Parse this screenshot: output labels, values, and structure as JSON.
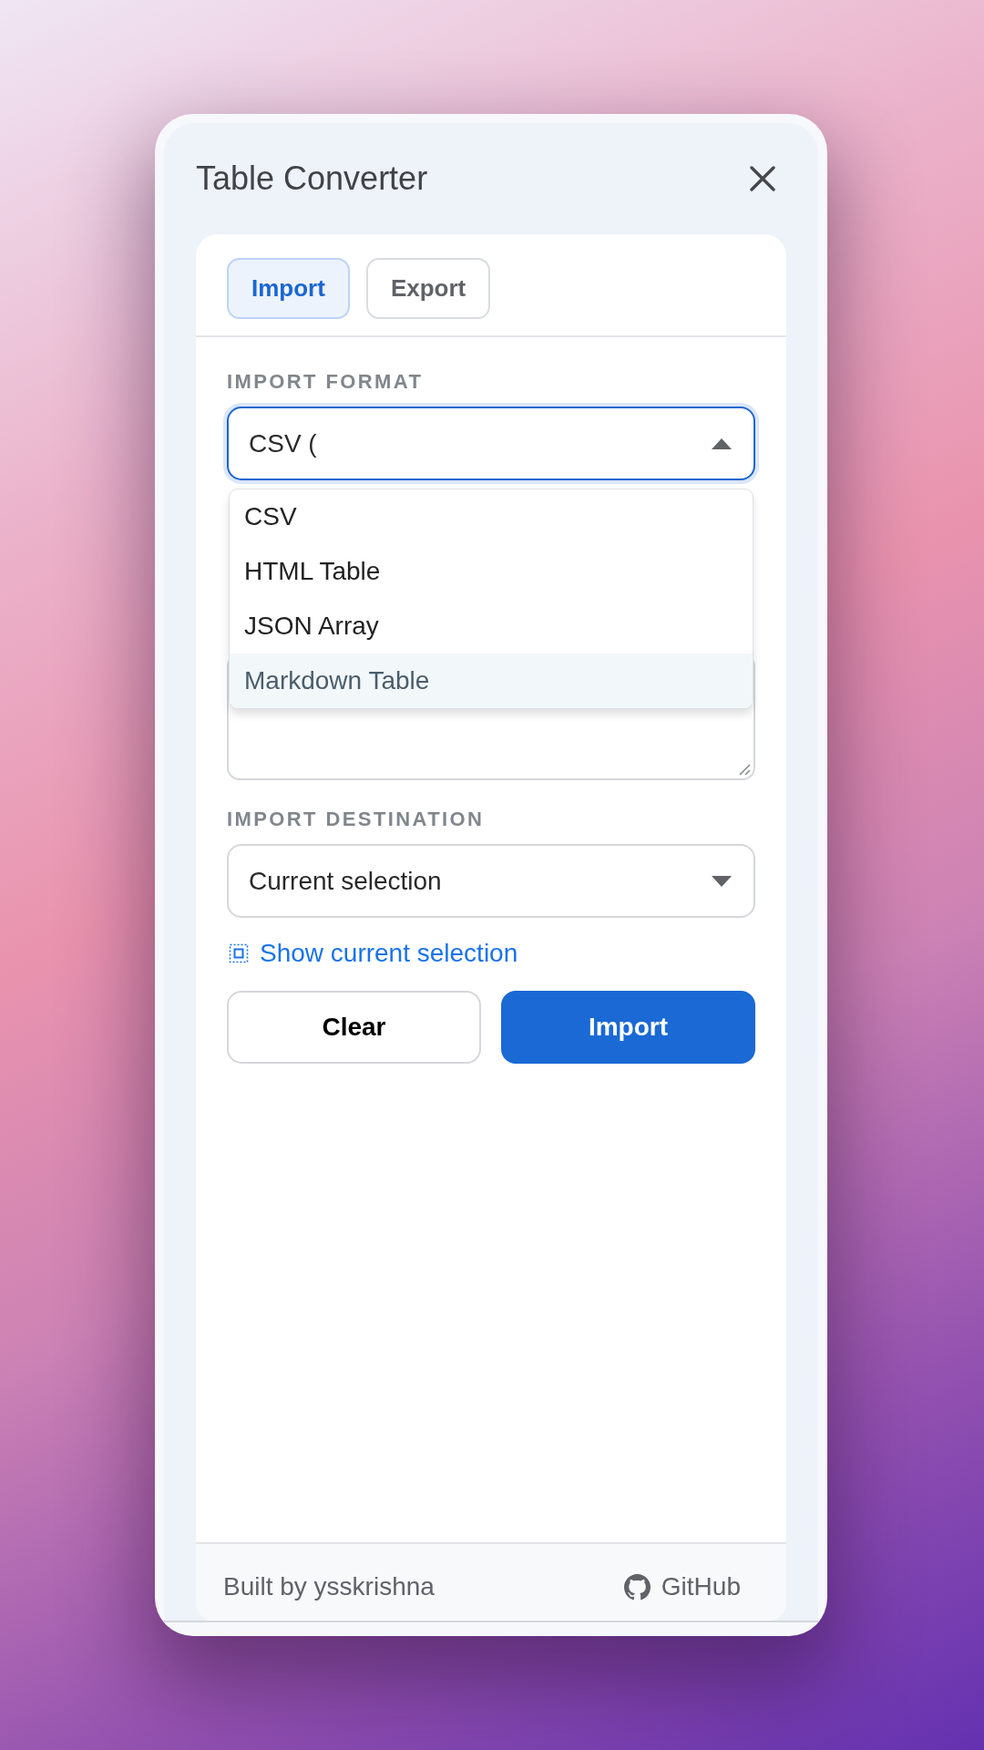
{
  "window": {
    "title": "Table Converter"
  },
  "tabs": [
    {
      "label": "Import",
      "selected": true
    },
    {
      "label": "Export",
      "selected": false
    }
  ],
  "format": {
    "label": "IMPORT FORMAT",
    "value": "CSV (",
    "focused": true,
    "expanded": true,
    "options": [
      {
        "label": "CSV",
        "selected": false
      },
      {
        "label": "HTML Table",
        "selected": false
      },
      {
        "label": "JSON Array",
        "selected": false
      },
      {
        "label": "Markdown Table",
        "selected": true
      }
    ]
  },
  "destination": {
    "label": "IMPORT DESTINATION",
    "value": "Current selection",
    "focused": false,
    "expanded": false
  },
  "link": {
    "label": "Show current selection"
  },
  "buttons": [
    {
      "label": "Clear",
      "kind": "secondary"
    },
    {
      "label": "Import",
      "kind": "primary"
    }
  ],
  "footer": {
    "credit": "Built by ysskrishna",
    "link": "GitHub"
  }
}
